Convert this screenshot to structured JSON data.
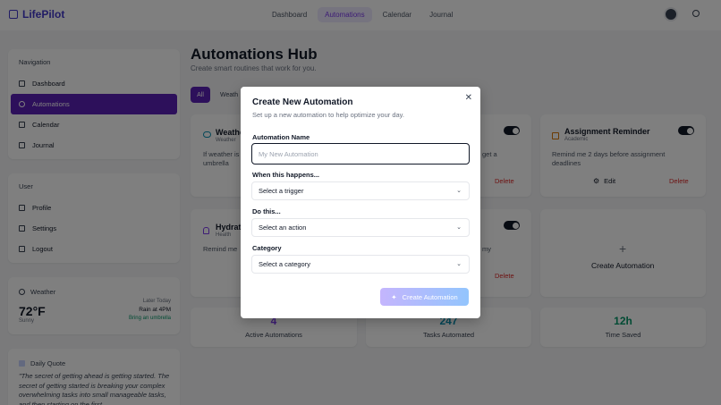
{
  "app": {
    "name": "LifePilot"
  },
  "nav": {
    "items": [
      "Dashboard",
      "Automations",
      "Calendar",
      "Journal"
    ],
    "active": "Automations"
  },
  "sidebar": {
    "navigation_title": "Navigation",
    "nav_items": [
      "Dashboard",
      "Automations",
      "Calendar",
      "Journal"
    ],
    "user_title": "User",
    "user_items": [
      "Profile",
      "Settings",
      "Logout"
    ]
  },
  "weather": {
    "title": "Weather",
    "temp": "72°F",
    "condition": "Sunny",
    "later_label": "Later Today",
    "later_forecast": "Rain at 4PM",
    "advice": "Bring an umbrella"
  },
  "quote": {
    "title": "Daily Quote",
    "text": "\"The secret of getting ahead is getting started. The secret of getting started is breaking your complex overwhelming tasks into small manageable tasks, and then starting on the first"
  },
  "main": {
    "title": "Automations Hub",
    "subtitle": "Create smart routines that work for you.",
    "filters": [
      "All",
      "Weath"
    ],
    "cards": [
      {
        "title": "Weathe",
        "category": "Weather",
        "desc1": "If weather is",
        "desc2": "umbrella"
      },
      {
        "desc": "get a"
      },
      {
        "title": "Assignment Reminder",
        "category": "Academic",
        "desc1": "Remind me 2 days before assignment",
        "desc2": "deadlines",
        "edit": "Edit",
        "delete": "Delete"
      },
      {
        "title": "Hydrati",
        "category": "Health",
        "desc1": "Remind me"
      },
      {
        "desc": "my"
      }
    ],
    "delete_label": "Delete",
    "create_label": "Create Automation",
    "stats": [
      {
        "value": "4",
        "label": "Active Automations",
        "color": "#7c3aed"
      },
      {
        "value": "247",
        "label": "Tasks Automated",
        "color": "#0891b2"
      },
      {
        "value": "12h",
        "label": "Time Saved",
        "color": "#059669"
      }
    ]
  },
  "modal": {
    "title": "Create New Automation",
    "subtitle": "Set up a new automation to help optimize your day.",
    "name_label": "Automation Name",
    "name_placeholder": "My New Automation",
    "trigger_label": "When this happens...",
    "trigger_value": "Select a trigger",
    "action_label": "Do this...",
    "action_value": "Select an action",
    "category_label": "Category",
    "category_value": "Select a category",
    "submit_label": "Create Automation"
  }
}
